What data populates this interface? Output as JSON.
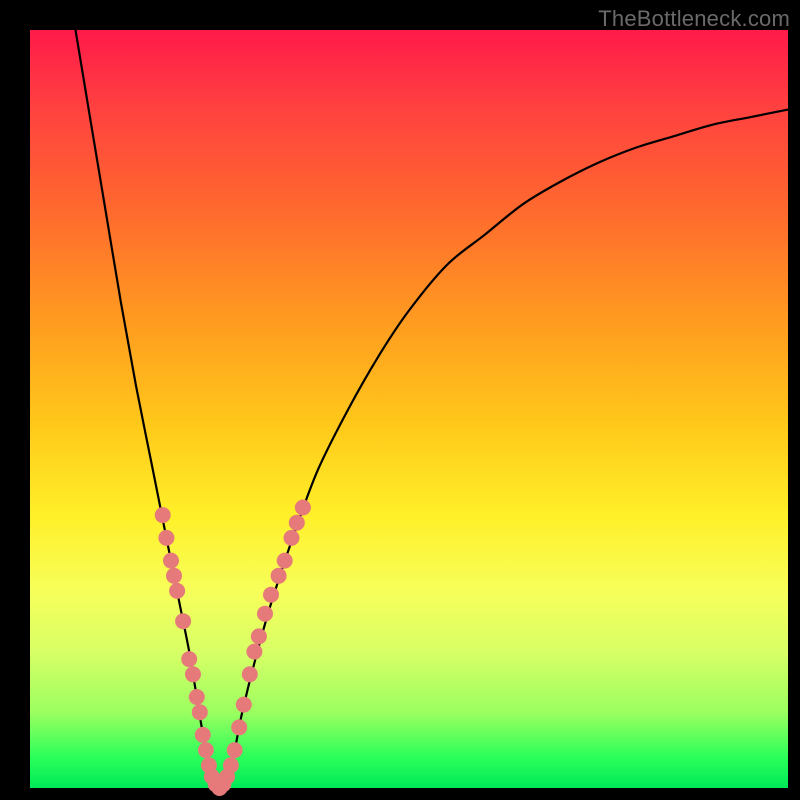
{
  "watermark": "TheBottleneck.com",
  "colors": {
    "background": "#000000",
    "marker": "#e67a7a",
    "curve": "#000000",
    "gradient_top": "#ff1a4a",
    "gradient_bottom": "#00e858"
  },
  "chart_data": {
    "type": "line",
    "title": "",
    "xlabel": "",
    "ylabel": "",
    "xlim": [
      0,
      100
    ],
    "ylim": [
      0,
      100
    ],
    "series": [
      {
        "name": "curve",
        "x": [
          6,
          8,
          10,
          12,
          14,
          16,
          18,
          19,
          20,
          21,
          22,
          23,
          24,
          25,
          26,
          27,
          28,
          30,
          32,
          35,
          38,
          42,
          46,
          50,
          55,
          60,
          65,
          70,
          75,
          80,
          85,
          90,
          95,
          100
        ],
        "y": [
          100,
          88,
          76,
          64,
          53,
          43,
          33,
          28,
          23,
          18,
          12,
          6,
          1,
          0,
          1,
          5,
          10,
          18,
          25,
          34,
          42,
          50,
          57,
          63,
          69,
          73,
          77,
          80,
          82.5,
          84.5,
          86,
          87.5,
          88.5,
          89.5
        ]
      }
    ],
    "markers": [
      {
        "x": 17.5,
        "y": 36
      },
      {
        "x": 18.0,
        "y": 33
      },
      {
        "x": 18.6,
        "y": 30
      },
      {
        "x": 19.0,
        "y": 28
      },
      {
        "x": 19.4,
        "y": 26
      },
      {
        "x": 20.2,
        "y": 22
      },
      {
        "x": 21.0,
        "y": 17
      },
      {
        "x": 21.5,
        "y": 15
      },
      {
        "x": 22.0,
        "y": 12
      },
      {
        "x": 22.4,
        "y": 10
      },
      {
        "x": 22.8,
        "y": 7
      },
      {
        "x": 23.2,
        "y": 5
      },
      {
        "x": 23.6,
        "y": 3
      },
      {
        "x": 24.0,
        "y": 1.5
      },
      {
        "x": 24.5,
        "y": 0.5
      },
      {
        "x": 25.0,
        "y": 0
      },
      {
        "x": 25.5,
        "y": 0.5
      },
      {
        "x": 26.0,
        "y": 1.5
      },
      {
        "x": 26.5,
        "y": 3
      },
      {
        "x": 27.0,
        "y": 5
      },
      {
        "x": 27.6,
        "y": 8
      },
      {
        "x": 28.2,
        "y": 11
      },
      {
        "x": 29.0,
        "y": 15
      },
      {
        "x": 29.6,
        "y": 18
      },
      {
        "x": 30.2,
        "y": 20
      },
      {
        "x": 31.0,
        "y": 23
      },
      {
        "x": 31.8,
        "y": 25.5
      },
      {
        "x": 32.8,
        "y": 28
      },
      {
        "x": 33.6,
        "y": 30
      },
      {
        "x": 34.5,
        "y": 33
      },
      {
        "x": 35.2,
        "y": 35
      },
      {
        "x": 36.0,
        "y": 37
      }
    ]
  }
}
